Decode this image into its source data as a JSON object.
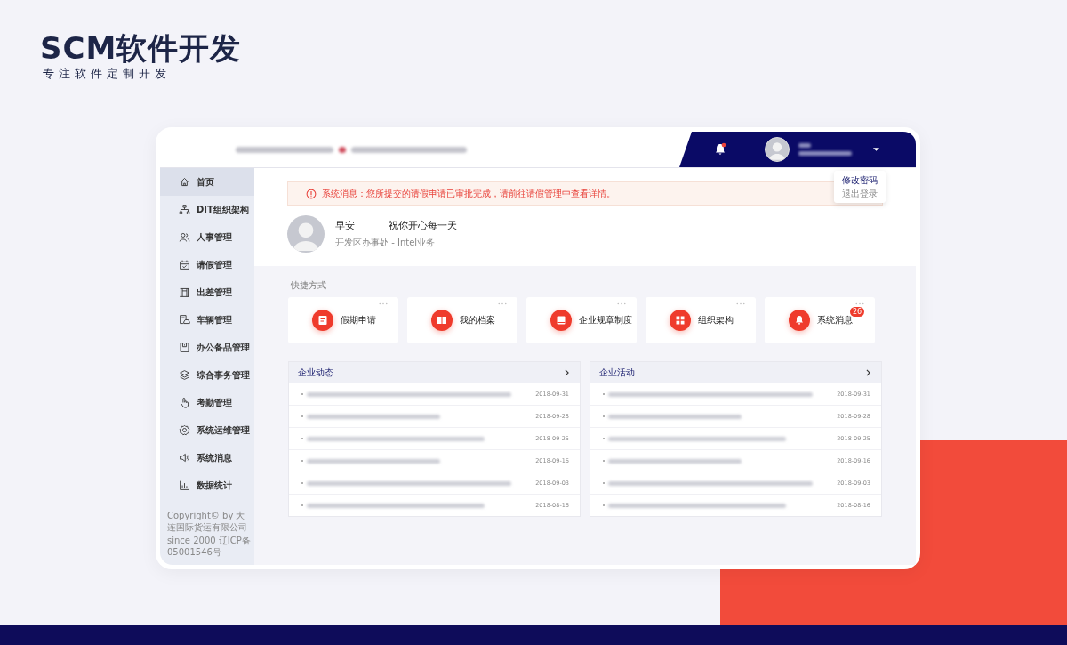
{
  "brand": {
    "title": "SCM软件开发",
    "subtitle": "专注软件定制开发"
  },
  "header": {
    "notification_dot": true,
    "user_menu": [
      {
        "label": "修改密码",
        "selected": true
      },
      {
        "label": "退出登录",
        "selected": false
      }
    ]
  },
  "sidebar": {
    "items": [
      {
        "label": "首页",
        "selected": true
      },
      {
        "label": "DIT组织架构",
        "selected": false
      },
      {
        "label": "人事管理",
        "selected": false
      },
      {
        "label": "请假管理",
        "selected": false
      },
      {
        "label": "出差管理",
        "selected": false
      },
      {
        "label": "车辆管理",
        "selected": false
      },
      {
        "label": "办公备品管理",
        "selected": false
      },
      {
        "label": "综合事务管理",
        "selected": false
      },
      {
        "label": "考勤管理",
        "selected": false
      },
      {
        "label": "系统运维管理",
        "selected": false
      },
      {
        "label": "系统消息",
        "selected": false
      },
      {
        "label": "数据统计",
        "selected": false
      }
    ],
    "copyright": [
      "Copyright© by 大连国际货运有限公司",
      "since 2000 辽ICP备05001546号"
    ]
  },
  "notice": "系统消息：您所提交的请假申请已审批完成，请前往请假管理中查看详情。",
  "greeting": {
    "hello": "早安",
    "wish": "祝你开心每一天",
    "dept": "开发区办事处 - Intel业务"
  },
  "shortcuts": {
    "title": "快捷方式",
    "items": [
      {
        "label": "假期申请"
      },
      {
        "label": "我的档案"
      },
      {
        "label": "企业规章制度"
      },
      {
        "label": "组织架构"
      },
      {
        "label": "系统消息",
        "badge": "26"
      }
    ]
  },
  "panels": [
    {
      "title": "企业动态",
      "rows": [
        {
          "date": "2018-09-31"
        },
        {
          "date": "2018-09-28"
        },
        {
          "date": "2018-09-25"
        },
        {
          "date": "2018-09-16"
        },
        {
          "date": "2018-09-03"
        },
        {
          "date": "2018-08-16"
        }
      ]
    },
    {
      "title": "企业活动",
      "rows": [
        {
          "date": "2018-09-31"
        },
        {
          "date": "2018-09-28"
        },
        {
          "date": "2018-09-25"
        },
        {
          "date": "2018-09-16"
        },
        {
          "date": "2018-09-03"
        },
        {
          "date": "2018-08-16"
        }
      ]
    }
  ]
}
